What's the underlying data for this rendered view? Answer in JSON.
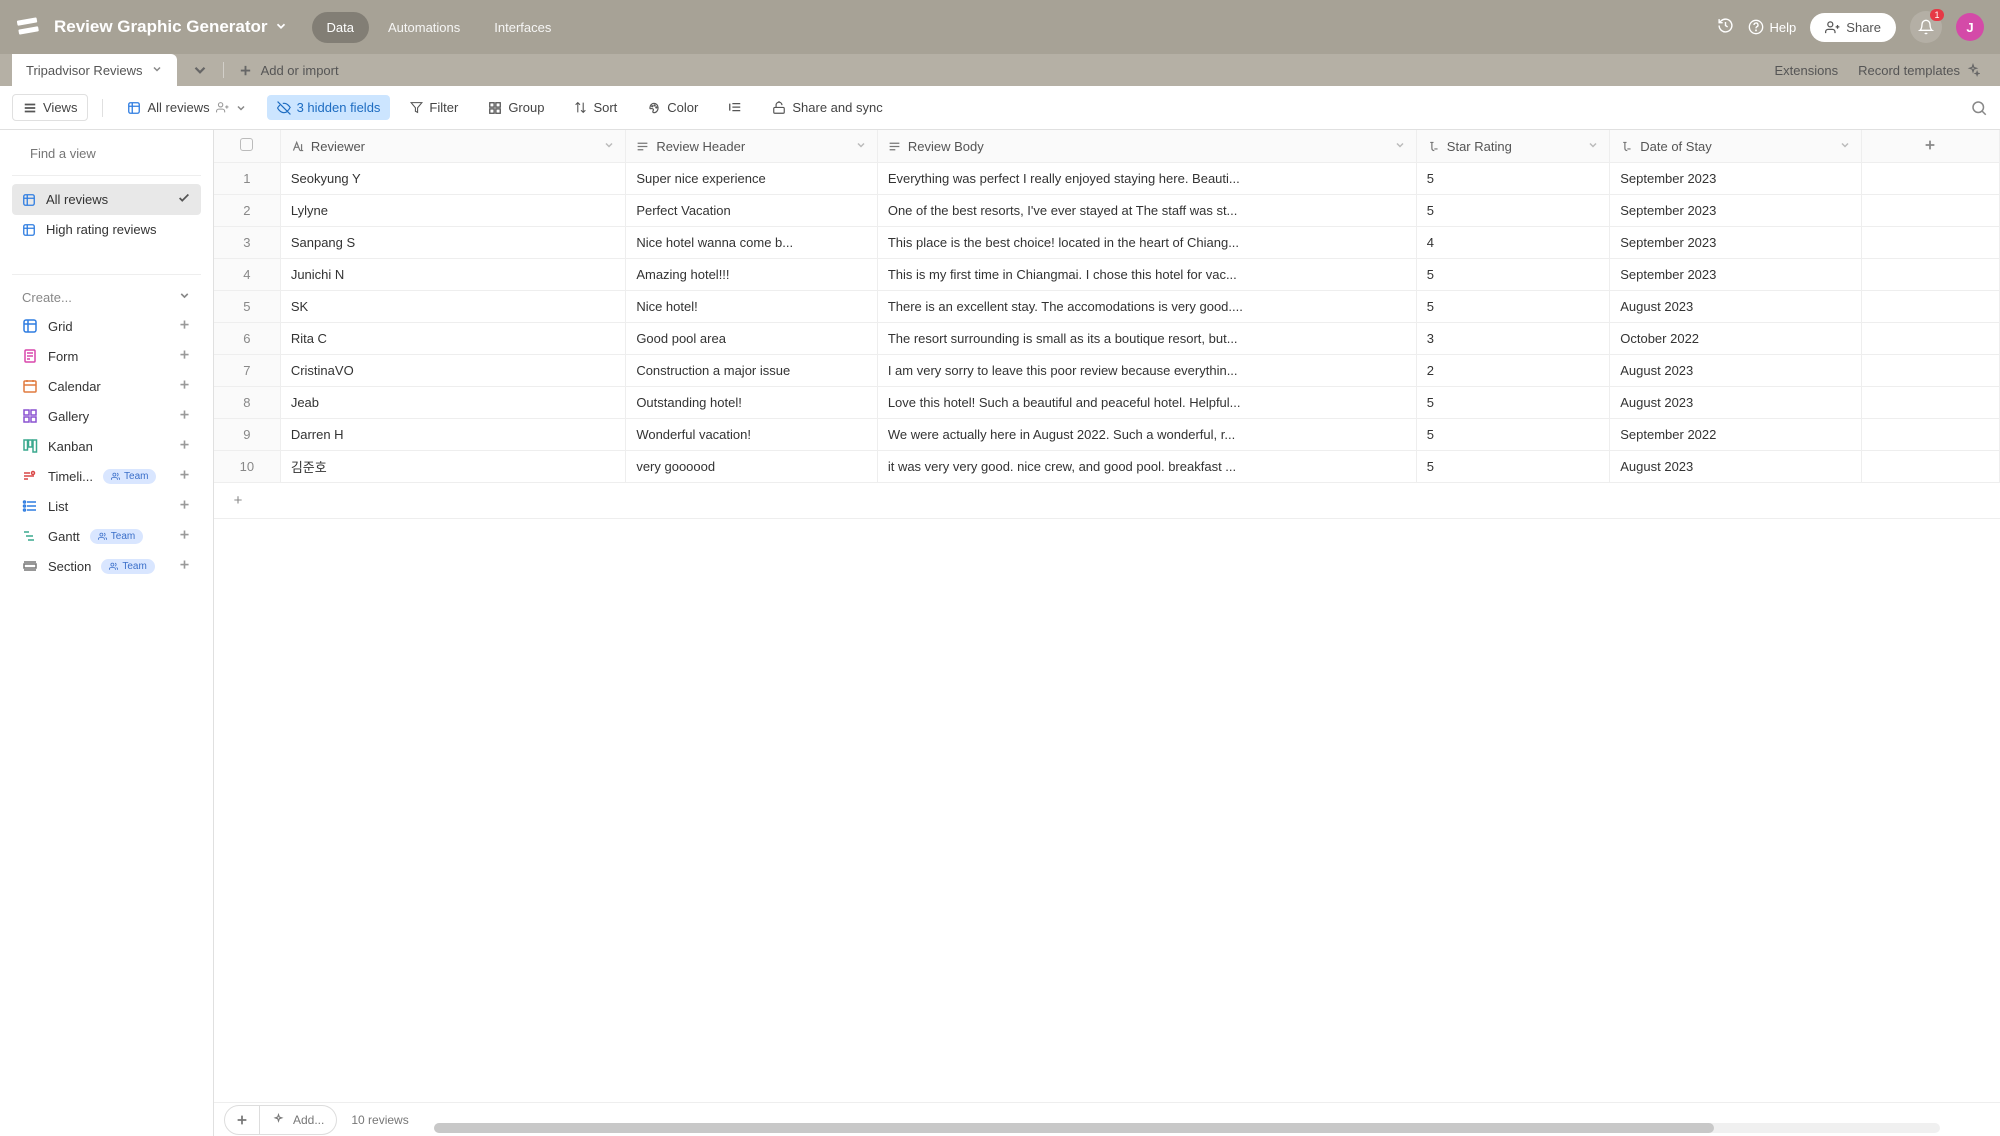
{
  "header": {
    "app_title": "Review Graphic Generator",
    "tabs": [
      {
        "label": "Data",
        "active": true
      },
      {
        "label": "Automations",
        "active": false
      },
      {
        "label": "Interfaces",
        "active": false
      }
    ],
    "help_label": "Help",
    "share_label": "Share",
    "notif_count": "1",
    "avatar_initial": "J"
  },
  "subheader": {
    "table_name": "Tripadvisor Reviews",
    "add_import_label": "Add or import",
    "extensions_label": "Extensions",
    "record_templates_label": "Record templates"
  },
  "toolbar": {
    "views_label": "Views",
    "current_view_label": "All reviews",
    "hidden_fields_label": "3 hidden fields",
    "filter_label": "Filter",
    "group_label": "Group",
    "sort_label": "Sort",
    "color_label": "Color",
    "share_sync_label": "Share and sync"
  },
  "sidebar": {
    "search_placeholder": "Find a view",
    "views": [
      {
        "label": "All reviews",
        "active": true,
        "checked": true
      },
      {
        "label": "High rating reviews",
        "active": false,
        "checked": false
      }
    ],
    "create_label": "Create...",
    "create_options": [
      {
        "label": "Grid",
        "team": false,
        "icon": "grid",
        "color": "#2f7de1"
      },
      {
        "label": "Form",
        "team": false,
        "icon": "form",
        "color": "#d946ab"
      },
      {
        "label": "Calendar",
        "team": false,
        "icon": "calendar",
        "color": "#e07a3e"
      },
      {
        "label": "Gallery",
        "team": false,
        "icon": "gallery",
        "color": "#8a52d1"
      },
      {
        "label": "Kanban",
        "team": false,
        "icon": "kanban",
        "color": "#3aa88e"
      },
      {
        "label": "Timeli...",
        "team": true,
        "icon": "timeline",
        "color": "#d94646"
      },
      {
        "label": "List",
        "team": false,
        "icon": "list",
        "color": "#2f7de1"
      },
      {
        "label": "Gantt",
        "team": true,
        "icon": "gantt",
        "color": "#3aa88e"
      },
      {
        "label": "Section",
        "team": true,
        "icon": "section",
        "color": "#777"
      }
    ],
    "team_badge_label": "Team"
  },
  "grid": {
    "columns": [
      {
        "key": "reviewer",
        "label": "Reviewer",
        "icon": "text"
      },
      {
        "key": "header",
        "label": "Review Header",
        "icon": "longtext"
      },
      {
        "key": "body",
        "label": "Review Body",
        "icon": "longtext"
      },
      {
        "key": "star",
        "label": "Star Rating",
        "icon": "formula"
      },
      {
        "key": "date",
        "label": "Date of Stay",
        "icon": "formula"
      }
    ],
    "rows": [
      {
        "n": "1",
        "reviewer": "Seokyung Y",
        "header": "Super nice experience",
        "body": "Everything was perfect I really enjoyed staying here. Beauti...",
        "star": "5",
        "date": "September 2023"
      },
      {
        "n": "2",
        "reviewer": "Lylyne",
        "header": "Perfect Vacation",
        "body": "One of the best resorts, I've ever stayed at The staff was st...",
        "star": "5",
        "date": "September 2023"
      },
      {
        "n": "3",
        "reviewer": "Sanpang S",
        "header": "Nice hotel wanna come b...",
        "body": "This place is the best choice! located in the heart of Chiang...",
        "star": "4",
        "date": "September 2023"
      },
      {
        "n": "4",
        "reviewer": "Junichi N",
        "header": "Amazing hotel!!!",
        "body": "This is my first time in Chiangmai. I chose this hotel for vac...",
        "star": "5",
        "date": "September 2023"
      },
      {
        "n": "5",
        "reviewer": "SK",
        "header": "Nice hotel!",
        "body": "There is an excellent stay. The accomodations is very good....",
        "star": "5",
        "date": "August 2023"
      },
      {
        "n": "6",
        "reviewer": "Rita C",
        "header": "Good pool area",
        "body": "The resort surrounding is small as its a boutique resort, but...",
        "star": "3",
        "date": "October 2022"
      },
      {
        "n": "7",
        "reviewer": "CristinaVO",
        "header": "Construction a major issue",
        "body": "I am very sorry to leave this poor review because everythin...",
        "star": "2",
        "date": "August 2023"
      },
      {
        "n": "8",
        "reviewer": "Jeab",
        "header": "Outstanding hotel!",
        "body": "Love this hotel! Such a beautiful and peaceful hotel. Helpful...",
        "star": "5",
        "date": "August 2023"
      },
      {
        "n": "9",
        "reviewer": "Darren H",
        "header": "Wonderful vacation!",
        "body": "We were actually here in August 2022. Such a wonderful, r...",
        "star": "5",
        "date": "September 2022"
      },
      {
        "n": "10",
        "reviewer": "김준호",
        "header": "very goooood",
        "body": "it was very very good. nice crew, and good pool. breakfast ...",
        "star": "5",
        "date": "August 2023"
      }
    ],
    "add_label": "Add...",
    "record_count_label": "10 reviews"
  }
}
